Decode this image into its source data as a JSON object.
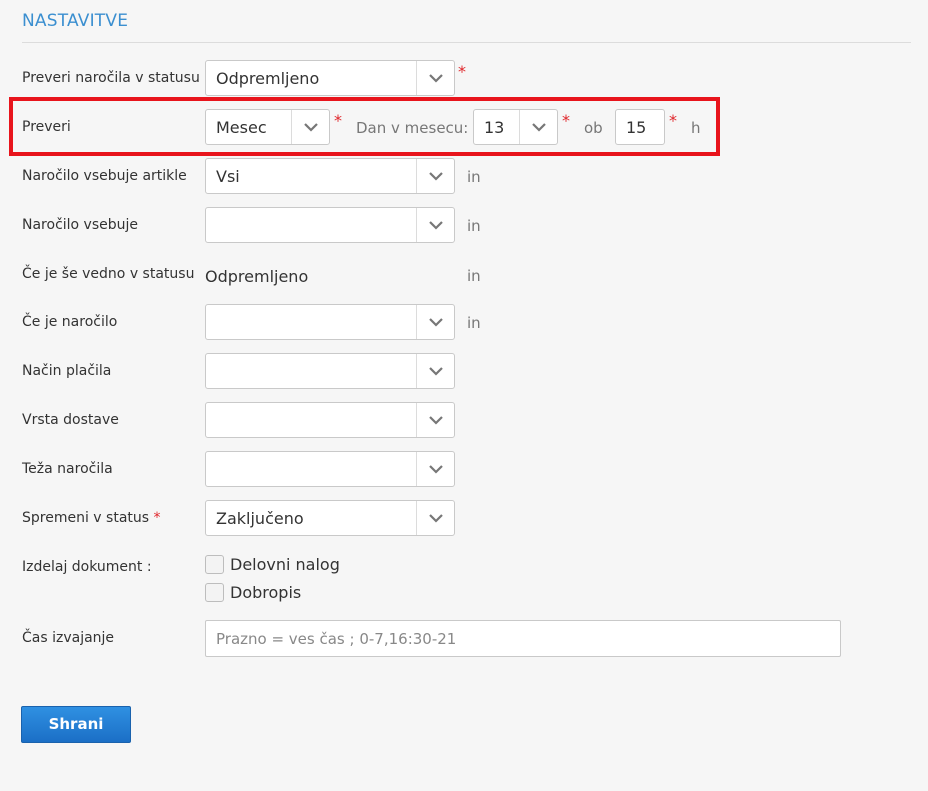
{
  "section": {
    "title": "NASTAVITVE"
  },
  "rows": {
    "check_status": {
      "label": "Preveri naročila v statusu",
      "value": "Odpremljeno",
      "required": "*"
    },
    "check": {
      "label": "Preveri",
      "period": "Mesec",
      "required": "*",
      "day_label": "Dan v mesecu:",
      "day": "13",
      "at_label": "ob",
      "hour": "15",
      "hour_unit": "h"
    },
    "contains_articles": {
      "label": "Naročilo vsebuje artikle",
      "value": "Vsi",
      "suffix": "in"
    },
    "contains": {
      "label": "Naročilo vsebuje",
      "value": "",
      "suffix": "in"
    },
    "still_status": {
      "label": "Če je še vedno v statusu",
      "value": "Odpremljeno",
      "suffix": "in"
    },
    "if_order": {
      "label": "Če je naročilo",
      "value": "",
      "suffix": "in"
    },
    "payment": {
      "label": "Način plačila",
      "value": ""
    },
    "shipping": {
      "label": "Vrsta dostave",
      "value": ""
    },
    "weight": {
      "label": "Teža naročila",
      "value": ""
    },
    "change_status": {
      "label": "Spremeni v status",
      "required": "*",
      "value": "Zaključeno"
    },
    "document": {
      "label": "Izdelaj dokument :",
      "options": [
        {
          "label": "Delovni nalog",
          "checked": false
        },
        {
          "label": "Dobropis",
          "checked": false
        }
      ]
    },
    "exec_time": {
      "label": "Čas izvajanje",
      "value": "",
      "placeholder": "Prazno = ves čas ; 0-7,16:30-21"
    }
  },
  "actions": {
    "save": "Shrani"
  },
  "colors": {
    "accent": "#3b8fd0",
    "required": "#e0262b",
    "highlight": "#e8141c",
    "button": "#1b6fc6"
  }
}
